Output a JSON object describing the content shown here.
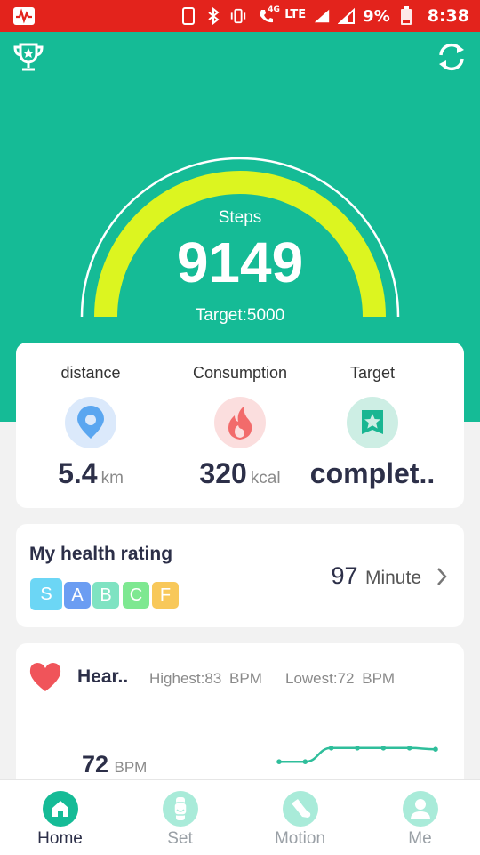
{
  "status_bar": {
    "time": "8:38",
    "battery": "9%",
    "network": "LTE",
    "network_sub": "4G",
    "colors": {
      "background": "#e3231c"
    }
  },
  "header": {
    "trophy_icon": "trophy-icon",
    "sync_icon": "sync-icon"
  },
  "gauge": {
    "label": "Steps",
    "value": "9149",
    "target_text": "Target:5000",
    "progress": 1.0,
    "colors": {
      "arc": "#dcf520",
      "outline": "#ffffff",
      "background": "#15bb96"
    }
  },
  "stats": [
    {
      "title": "distance",
      "value": "5.4",
      "unit": "km",
      "icon": "location-pin-icon",
      "color": "#5aa6f0"
    },
    {
      "title": "Consumption",
      "value": "320",
      "unit": "kcal",
      "icon": "flame-icon",
      "color": "#f26b6b"
    },
    {
      "title": "Target",
      "value": "complet..",
      "unit": "",
      "icon": "badge-star-icon",
      "color": "#19b692"
    }
  ],
  "health_rating": {
    "title": "My health rating",
    "value": "97",
    "unit": "Minute",
    "grades": [
      {
        "label": "S",
        "color": "#6cd6f5"
      },
      {
        "label": "A",
        "color": "#6b9df2"
      },
      {
        "label": "B",
        "color": "#7fe3c2"
      },
      {
        "label": "C",
        "color": "#7ee891"
      },
      {
        "label": "F",
        "color": "#f8c85a"
      }
    ]
  },
  "heart": {
    "title": "Hear..",
    "highest": "Highest:83",
    "lowest": "Lowest:72",
    "bpm_unit": "BPM",
    "current_value": "72",
    "current_unit": "BPM",
    "trend": [
      72,
      72,
      83,
      83,
      83,
      83,
      82
    ],
    "trend_range": [
      60,
      90
    ],
    "colors": {
      "line": "#2fbe9b",
      "heart": "#f0545a"
    }
  },
  "bottom_nav": [
    {
      "label": "Home",
      "icon": "home-icon",
      "active": true
    },
    {
      "label": "Set",
      "icon": "watch-icon",
      "active": false
    },
    {
      "label": "Motion",
      "icon": "shoe-icon",
      "active": false
    },
    {
      "label": "Me",
      "icon": "person-icon",
      "active": false
    }
  ],
  "colors": {
    "brand": "#15bb96",
    "inactive_nav": "#9aa0a6"
  }
}
